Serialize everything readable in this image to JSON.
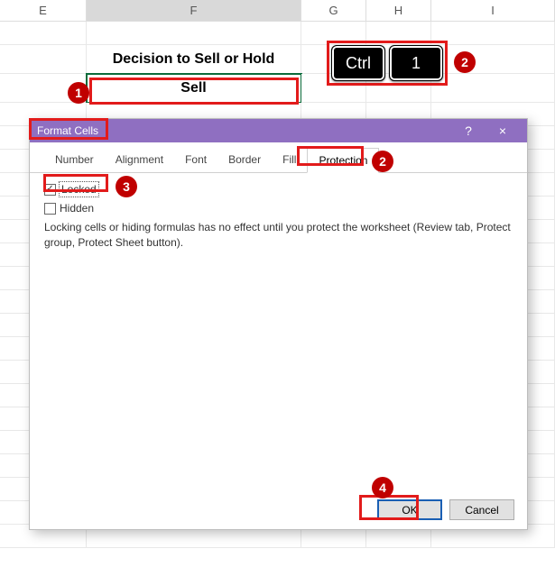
{
  "columns": {
    "E": "E",
    "F": "F",
    "G": "G",
    "H": "H",
    "I": "I"
  },
  "cells": {
    "heading": "Decision to Sell or Hold",
    "sell": "Sell"
  },
  "keys": {
    "ctrl": "Ctrl",
    "one": "1"
  },
  "callouts": {
    "c1": "1",
    "c2k": "2",
    "c2": "2",
    "c3": "3",
    "c4": "4"
  },
  "dialog": {
    "title": "Format Cells",
    "help": "?",
    "close": "×",
    "tabs": {
      "number": "Number",
      "alignment": "Alignment",
      "font": "Font",
      "border": "Border",
      "fill": "Fill",
      "protection": "Protection"
    },
    "locked_label": "Locked",
    "locked_check": "✓",
    "hidden_label": "Hidden",
    "note": "Locking cells or hiding formulas has no effect until you protect the worksheet (Review tab, Protect group, Protect Sheet button).",
    "ok": "OK",
    "cancel": "Cancel"
  }
}
